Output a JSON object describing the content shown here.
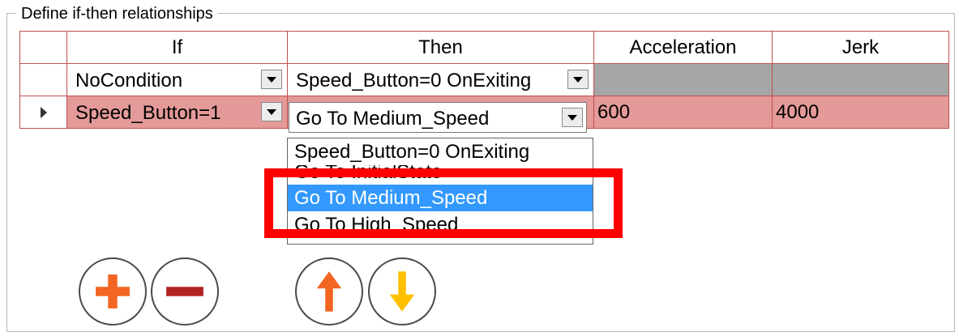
{
  "group_title": "Define if-then relationships",
  "grid": {
    "headers": {
      "if": "If",
      "then": "Then",
      "acceleration": "Acceleration",
      "jerk": "Jerk"
    },
    "rows": [
      {
        "if": "NoCondition",
        "then": "Speed_Button=0 OnExiting",
        "acceleration": "",
        "jerk": ""
      },
      {
        "if": "Speed_Button=1",
        "then": "Go To  Medium_Speed",
        "acceleration": "600",
        "jerk": "4000",
        "current": true
      }
    ]
  },
  "dropdown": {
    "options": [
      "Speed_Button=0 OnExiting",
      "Go To  InitialState",
      "Go To  Medium_Speed",
      "Go To  High_Speed"
    ],
    "selected_index": 2
  },
  "buttons": {
    "add": "add-row",
    "remove": "remove-row",
    "up": "move-up",
    "down": "move-down"
  },
  "colors": {
    "grid_border": "#c0504d",
    "row_disabled": "#a6a6a6",
    "row_current": "#e39a98",
    "selection": "#3399ff",
    "highlight": "#ff0000",
    "add_orange": "#f26522",
    "remove_red": "#b22222",
    "up_orange": "#f26522",
    "down_yellow": "#ffc000"
  }
}
